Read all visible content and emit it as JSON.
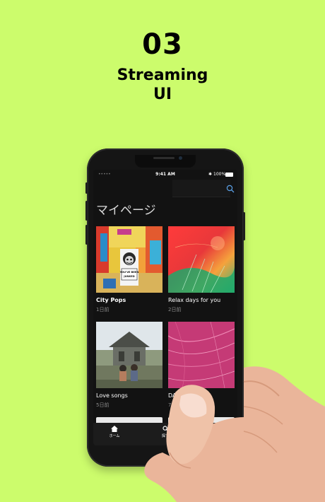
{
  "hero": {
    "number": "03",
    "title_line1": "Streaming",
    "title_line2": "UI"
  },
  "status": {
    "time": "9:41 AM",
    "battery": "100%"
  },
  "page": {
    "title": "マイページ"
  },
  "cards": [
    {
      "title": "City Pops",
      "subtitle": "1日前",
      "poster_line1": "YOU'VE BEEN",
      "poster_line2": "JUNKED"
    },
    {
      "title": "Relax days for you",
      "subtitle": "2日前"
    },
    {
      "title": "Love songs",
      "subtitle": "5日前"
    },
    {
      "title": "DANCE",
      "subtitle": "7日前"
    }
  ],
  "tabs": [
    {
      "label": "ホーム",
      "icon": "home-icon"
    },
    {
      "label": "探す",
      "icon": "search-icon"
    }
  ],
  "colors": {
    "background": "#ccfc6c",
    "screen": "#121212"
  }
}
